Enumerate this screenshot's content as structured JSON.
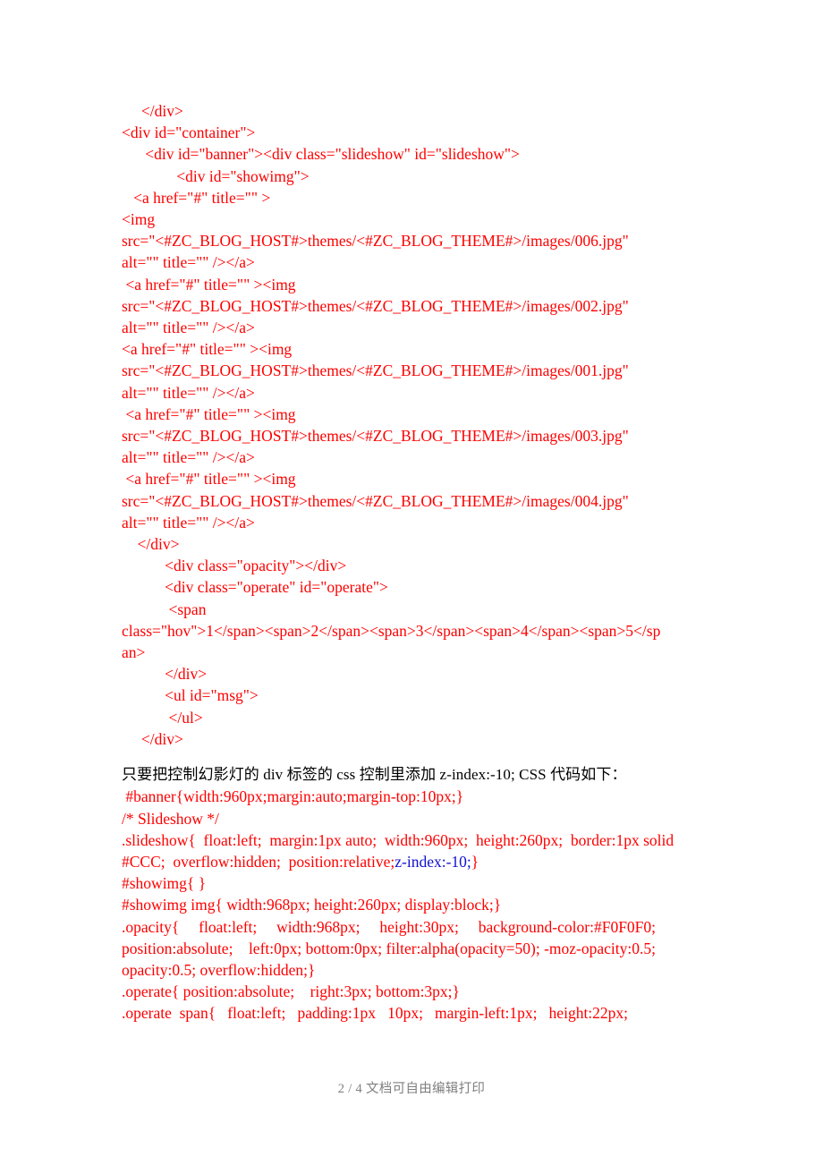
{
  "document": {
    "page_label": "2 / 4 文档可自由编辑打印",
    "page_number": "2",
    "page_total": "4",
    "code_color": "#FF0000",
    "highlight_color": "#1010D0",
    "body_color": "#000000",
    "footer_color": "#808080"
  },
  "code_block_1": {
    "lines": [
      "     </div>",
      "<div id=\"container\">",
      "      <div id=\"banner\"><div class=\"slideshow\" id=\"slideshow\">",
      "              <div id=\"showimg\">",
      "   <a href=\"#\" title=\"\" >",
      "<img",
      "src=\"<#ZC_BLOG_HOST#>themes/<#ZC_BLOG_THEME#>/images/006.jpg\"",
      "alt=\"\" title=\"\" /></a>",
      " <a href=\"#\" title=\"\" ><img",
      "src=\"<#ZC_BLOG_HOST#>themes/<#ZC_BLOG_THEME#>/images/002.jpg\"",
      "alt=\"\" title=\"\" /></a>",
      "<a href=\"#\" title=\"\" ><img",
      "src=\"<#ZC_BLOG_HOST#>themes/<#ZC_BLOG_THEME#>/images/001.jpg\"",
      "alt=\"\" title=\"\" /></a>",
      " <a href=\"#\" title=\"\" ><img",
      "src=\"<#ZC_BLOG_HOST#>themes/<#ZC_BLOG_THEME#>/images/003.jpg\"",
      "alt=\"\" title=\"\" /></a>",
      " <a href=\"#\" title=\"\" ><img",
      "src=\"<#ZC_BLOG_HOST#>themes/<#ZC_BLOG_THEME#>/images/004.jpg\"",
      "alt=\"\" title=\"\" /></a>",
      "    </div>",
      "           <div class=\"opacity\"></div>",
      "           <div class=\"operate\" id=\"operate\">",
      "            <span",
      "class=\"hov\">1</span><span>2</span><span>3</span><span>4</span><span>5</sp",
      "an>",
      "           </div>",
      "           <ul id=\"msg\">",
      "            </ul>",
      "",
      "     </div>"
    ]
  },
  "paragraph": {
    "text": "只要把控制幻影灯的 div 标签的 css 控制里添加  z-index:-10; CSS 代码如下："
  },
  "code_block_2": {
    "line_banner": " #banner{width:960px;margin:auto;margin-top:10px;}",
    "line_comment": "/* Slideshow */",
    "line_slideshow_a": ".slideshow{  float:left;  margin:1px auto;  width:960px;  height:260px;  border:1px solid",
    "line_slideshow_b_pre": "#CCC;  overflow:hidden;  position:relative;",
    "line_slideshow_b_hl": "z-index:-10;",
    "line_slideshow_b_post": "}",
    "line_showimg": "#showimg{ }",
    "line_showimg_img": "#showimg img{ width:968px; height:260px; display:block;}",
    "line_opacity_a": ".opacity{     float:left;     width:968px;     height:30px;     background-color:#F0F0F0;",
    "line_opacity_b": "position:absolute;    left:0px; bottom:0px; filter:alpha(opacity=50); -moz-opacity:0.5;",
    "line_opacity_c": "opacity:0.5; overflow:hidden;}",
    "line_operate": ".operate{ position:absolute;    right:3px; bottom:3px;}",
    "line_operate_span": ".operate  span{   float:left;   padding:1px   10px;   margin-left:1px;   height:22px;"
  }
}
